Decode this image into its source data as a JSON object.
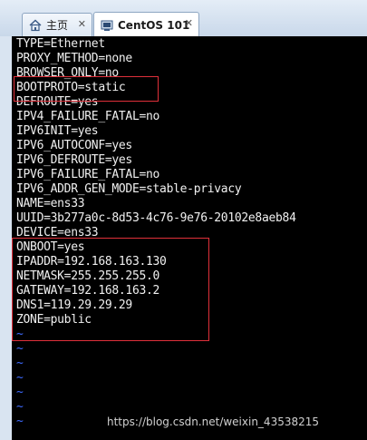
{
  "tabs": [
    {
      "label": "主页",
      "icon": "home-icon",
      "close": "✕"
    },
    {
      "label": "CentOS 101",
      "icon": "vm-terminal-icon",
      "close": "✕"
    }
  ],
  "file_lines": [
    "TYPE=Ethernet",
    "PROXY_METHOD=none",
    "BROWSER_ONLY=no",
    "BOOTPROTO=static",
    "DEFROUTE=yes",
    "IPV4_FAILURE_FATAL=no",
    "IPV6INIT=yes",
    "IPV6_AUTOCONF=yes",
    "IPV6_DEFROUTE=yes",
    "IPV6_FAILURE_FATAL=no",
    "IPV6_ADDR_GEN_MODE=stable-privacy",
    "NAME=ens33",
    "UUID=3b277a0c-8d53-4c76-9e76-20102e8aeb84",
    "DEVICE=ens33",
    "ONBOOT=yes",
    "IPADDR=192.168.163.130",
    "NETMASK=255.255.255.0",
    "GATEWAY=192.168.163.2",
    "DNS1=119.29.29.29",
    "ZONE=public"
  ],
  "empty_line_marker": "~",
  "empty_line_count": 7,
  "watermark": "https://blog.csdn.net/weixin_43538215",
  "colors": {
    "terminal_bg": "#000000",
    "text": "#f0f0f0",
    "tilde": "#3d6bff",
    "highlight_box": "#e0303a"
  }
}
